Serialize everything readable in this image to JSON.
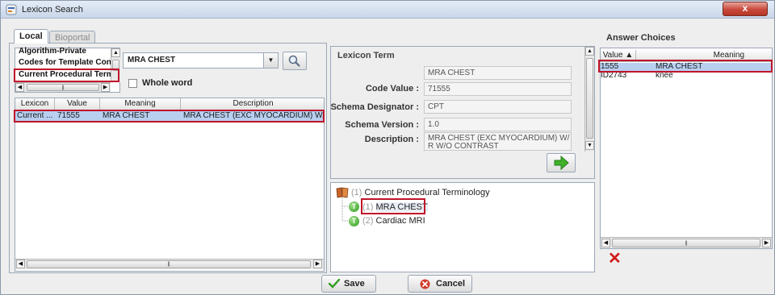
{
  "window": {
    "title": "Lexicon Search",
    "close_label": "x"
  },
  "tabs": [
    {
      "label": "Local"
    },
    {
      "label": "Bioportal"
    }
  ],
  "lexicon_list": {
    "items": [
      "Algorithm-Private",
      "Codes for Template Con",
      "Current Procedural Term"
    ],
    "h_thumb_glyph": "||"
  },
  "search": {
    "value": "MRA CHEST"
  },
  "whole_word": {
    "label": "Whole word",
    "checked": false
  },
  "results_table": {
    "columns": [
      "Lexicon",
      "Value",
      "Meaning",
      "Description"
    ],
    "rows": [
      {
        "lexicon": "Current ...",
        "value": "71555",
        "meaning": "MRA CHEST",
        "description": "MRA CHEST (EXC MYOCARDIUM) W/ O"
      }
    ]
  },
  "lexicon_term": {
    "header": "Lexicon Term",
    "term_value": "MRA CHEST",
    "fields": [
      {
        "label": "Code Value :",
        "value": "71555"
      },
      {
        "label": "Schema Designator :",
        "value": "CPT"
      },
      {
        "label": "Schema Version :",
        "value": "1.0"
      },
      {
        "label": "Description :",
        "value": "MRA CHEST (EXC MYOCARDIUM) W/ O",
        "value2": "R W/O CONTRAST"
      }
    ]
  },
  "tree": {
    "root": {
      "num": "(1)",
      "label": "Current Procedural Terminology"
    },
    "children": [
      {
        "num": "(1)",
        "label": "MRA CHEST"
      },
      {
        "num": "(2)",
        "label": "Cardiac MRI"
      }
    ],
    "icon_letter": "T"
  },
  "answer_choices": {
    "title": "Answer Choices",
    "columns": [
      "Value ▲",
      "Meaning"
    ],
    "rows": [
      {
        "value": "1555",
        "meaning": "MRA CHEST"
      },
      {
        "value": "ID2743",
        "meaning": "knee"
      }
    ]
  },
  "buttons": {
    "save": "Save",
    "cancel": "Cancel",
    "delete_glyph": "✕"
  },
  "colors": {
    "selection": "#b8cff0",
    "highlight_border": "#c0142a",
    "go_arrow": "#3fb128",
    "delete_red": "#d21a1a"
  }
}
